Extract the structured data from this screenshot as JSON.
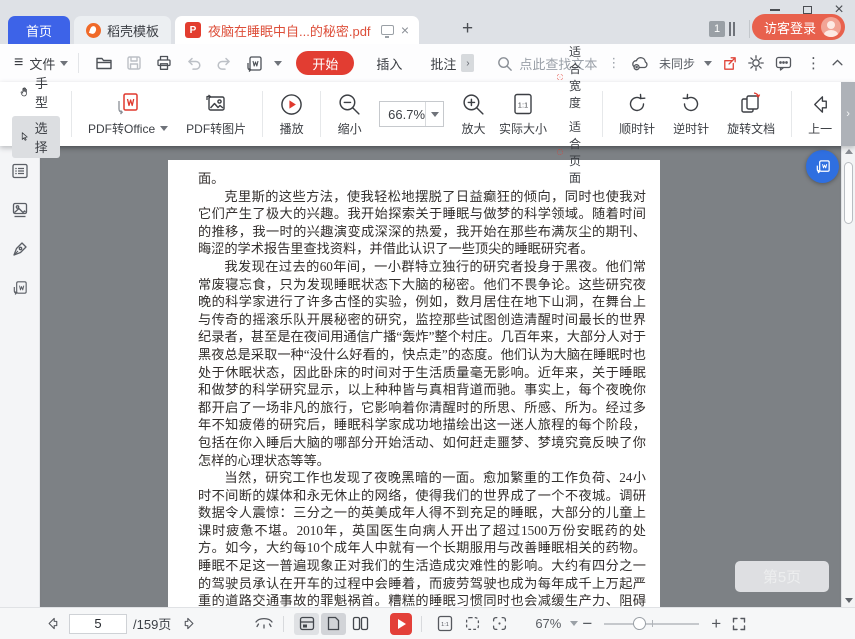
{
  "tabs": {
    "home_label": "首页",
    "docer_label": "稻壳模板",
    "doc_label": "夜脑在睡眠中自...的秘密.pdf",
    "open_tab_count": "1",
    "guest_login_label": "访客登录"
  },
  "menubar": {
    "file_label": "文件",
    "start_label": "开始",
    "insert_label": "插入",
    "comment_label": "批注",
    "search_placeholder": "点此查找文本",
    "sync_label": "未同步"
  },
  "toolbar": {
    "hand_label": "手型",
    "select_label": "选择",
    "pdf_to_office_label": "PDF转Office",
    "pdf_to_image_label": "PDF转图片",
    "play_label": "播放",
    "zoom_out_label": "缩小",
    "zoom_value": "66.7%",
    "zoom_in_label": "放大",
    "actual_size_label": "实际大小",
    "fit_width_label": "适合宽度",
    "fit_page_label": "适合页面",
    "rotate_cw_label": "顺时针",
    "rotate_ccw_label": "逆时针",
    "rotate_doc_label": "旋转文档",
    "prev_label": "上一"
  },
  "icons": {
    "pdf_glyph": "P",
    "word_glyph": "W",
    "actual_size_glyph": "1:1"
  },
  "document": {
    "page_toast": "第5页",
    "paragraphs": [
      "面。",
      "克里斯的这些方法，使我轻松地摆脱了日益癫狂的倾向，同时也使我对它们产生了极大的兴趣。我开始探索关于睡眠与做梦的科学领域。随着时间的推移，我一时的兴趣演变成深深的热爱，我开始在那些布满灰尘的期刊、晦涩的学术报告里查找资料，并借此认识了一些顶尖的睡眠研究者。",
      "我发现在过去的60年间，一小群特立独行的研究者投身于黑夜。他们常常废寝忘食，只为发现睡眠状态下大脑的秘密。他们不畏争论。这些研究夜晚的科学家进行了许多古怪的实验，例如，数月居住在地下山洞，在舞台上与传奇的摇滚乐队开展秘密的研究，监控那些试图创造清醒时间最长的世界纪录者，甚至是在夜间用通信广播“轰炸”整个村庄。几百年来，大部分人对于黑夜总是采取一种“没什么好看的，快点走”的态度。他们认为大脑在睡眠时也处于休眠状态，因此卧床的时间对于生活质量毫无影响。近年来，关于睡眠和做梦的科学研究显示，以上种种皆与真相背道而驰。事实上，每个夜晚你都开启了一场非凡的旅行，它影响着你清醒时的所思、所感、所为。经过多年不知疲倦的研究后，睡眠科学家成功地描绘出这一迷人旅程的每个阶段，包括在你入睡后大脑的哪部分开始活动、如何赶走噩梦、梦境究竟反映了你怎样的心理状态等等。",
      "当然，研究工作也发现了夜晚黑暗的一面。愈加繁重的工作负荷、24小时不间断的媒体和永无休止的网络，使得我们的世界成了一个不夜城。调研数据令人震惊：三分之一的英美成年人得不到充足的睡眠，大部分的儿童上课时疲惫不堪。2010年，英国医生向病人开出了超过1500万份安眠药的处方。如今，大约每10个成年人中就有一个长期服用与改善睡眠相关的药物。睡眠不足这一普遍现象正对我们的生活造成灾难性的影响。大约有四分之一的驾驶员承认在开车的过程中会睡着，而疲劳驾驶也成为每年成千上万起严重的道路交通事故的罪魁祸首。糟糕的睡眠习惯同时也会减缓生产力、阻碍学习、破坏人际关系、限制创造性思维。"
    ]
  },
  "statusbar": {
    "current_page": "5",
    "total_pages_label": "/159页",
    "zoom_percent": "67%"
  },
  "colors": {
    "accent_blue": "#3d63e8",
    "accent_red": "#e23d32",
    "title_red": "#dd4f3a",
    "guest_pill": "#e8614d",
    "fab_blue": "#2f6fe0"
  }
}
